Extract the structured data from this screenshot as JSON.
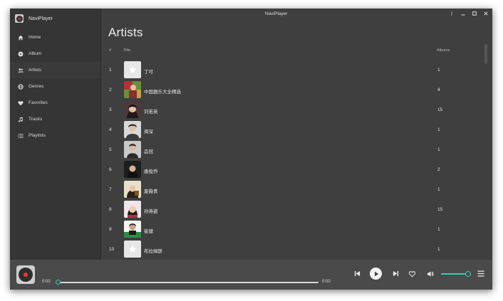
{
  "window": {
    "title": "NaviPlayer"
  },
  "app": {
    "name": "NaviPlayer",
    "logo_icon": "vinyl-record-icon"
  },
  "sidebar": {
    "items": [
      {
        "label": "Home",
        "icon": "home-icon",
        "active": false
      },
      {
        "label": "Album",
        "icon": "album-disc-icon",
        "active": false
      },
      {
        "label": "Artists",
        "icon": "people-icon",
        "active": true
      },
      {
        "label": "Genres",
        "icon": "globe-icon",
        "active": false
      },
      {
        "label": "Favorites",
        "icon": "heart-icon",
        "active": false
      },
      {
        "label": "Tracks",
        "icon": "music-note-icon",
        "active": false
      },
      {
        "label": "Playlists",
        "icon": "list-icon",
        "active": false
      }
    ]
  },
  "main": {
    "title": "Artists",
    "columns": {
      "num": "#",
      "title": "Title",
      "albums": "Albums"
    },
    "rows": [
      {
        "num": "1",
        "name": "丁可",
        "albums": "1"
      },
      {
        "num": "2",
        "name": "中国器乐大全精选",
        "albums": "4"
      },
      {
        "num": "3",
        "name": "刘若英",
        "albums": "15"
      },
      {
        "num": "4",
        "name": "周深",
        "albums": "1"
      },
      {
        "num": "5",
        "name": "品冠",
        "albums": "1"
      },
      {
        "num": "6",
        "name": "唐俊乔",
        "albums": "2"
      },
      {
        "num": "7",
        "name": "夏薇青",
        "albums": "1"
      },
      {
        "num": "8",
        "name": "孙燕姿",
        "albums": "15"
      },
      {
        "num": "9",
        "name": "崔健",
        "albums": "1"
      },
      {
        "num": "10",
        "name": "布拉姆斯",
        "albums": "1"
      }
    ]
  },
  "player": {
    "time_current": "0:00",
    "time_total": "0:00",
    "progress": 0,
    "volume": 1.0
  },
  "colors": {
    "accent": "#3cc9bb",
    "background": "#3f3f3f",
    "sidebar": "#353535",
    "player_bar": "#4a4a4a"
  }
}
